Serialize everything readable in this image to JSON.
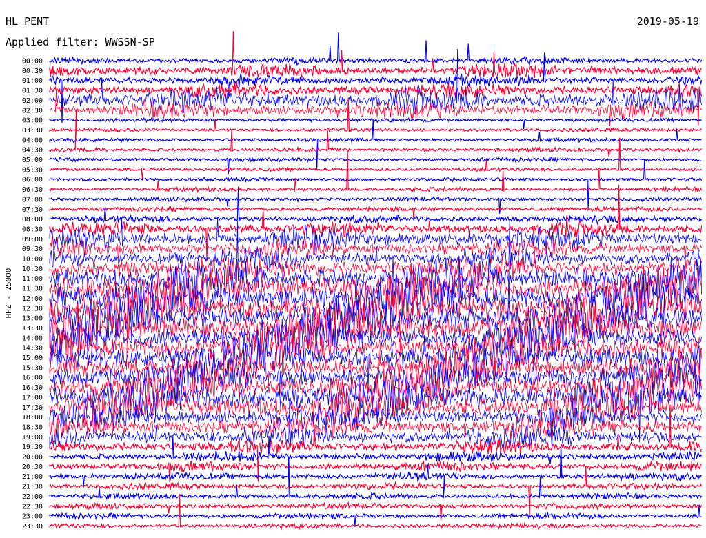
{
  "header": {
    "station": "HL PENT",
    "date": "2019-05-19",
    "filter": "Applied filter: WWSSN-SP"
  },
  "chart_data": {
    "type": "line",
    "subtype": "helicorder",
    "title": "HL PENT",
    "date": "2019-05-19",
    "filter": "WWSSN-SP",
    "ylabel": "HHZ - 25000",
    "row_labels": [
      "00:00",
      "00:30",
      "01:00",
      "01:30",
      "02:00",
      "02:30",
      "03:00",
      "03:30",
      "04:00",
      "04:30",
      "05:00",
      "05:30",
      "06:00",
      "06:30",
      "07:00",
      "07:30",
      "08:00",
      "08:30",
      "09:00",
      "09:30",
      "10:00",
      "10:30",
      "11:00",
      "11:30",
      "12:00",
      "12:30",
      "13:00",
      "13:30",
      "14:00",
      "14:30",
      "15:00",
      "15:30",
      "16:00",
      "16:30",
      "17:00",
      "17:30",
      "18:00",
      "18:30",
      "19:00",
      "19:30",
      "20:00",
      "20:30",
      "21:00",
      "21:30",
      "22:00",
      "22:30",
      "23:00",
      "23:30"
    ],
    "colors": [
      "#0000ff",
      "#ff0033"
    ],
    "row_activity": [
      0.12,
      0.28,
      0.22,
      0.3,
      0.55,
      0.38,
      0.05,
      0.05,
      0.05,
      0.06,
      0.06,
      0.05,
      0.05,
      0.06,
      0.06,
      0.07,
      0.14,
      0.3,
      0.5,
      0.45,
      0.5,
      0.6,
      0.85,
      0.95,
      1.0,
      1.0,
      1.0,
      0.95,
      0.9,
      0.85,
      0.9,
      0.8,
      0.85,
      0.85,
      0.9,
      0.8,
      0.55,
      0.55,
      0.5,
      0.3,
      0.2,
      0.2,
      0.15,
      0.12,
      0.1,
      0.1,
      0.1,
      0.08
    ]
  }
}
